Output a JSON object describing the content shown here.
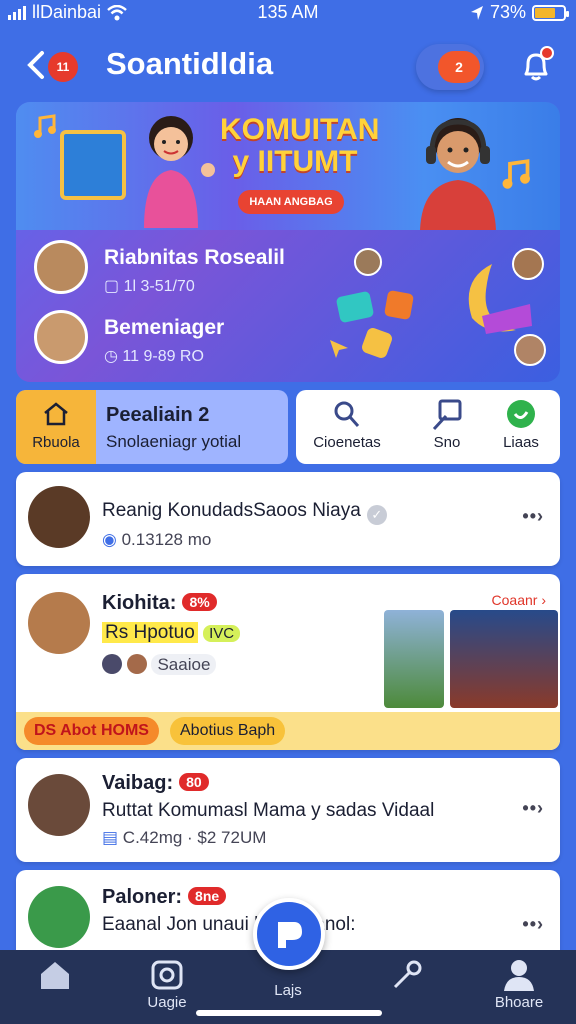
{
  "status_bar": {
    "carrier": "llDainbai",
    "time": "135 AM",
    "battery": "73%"
  },
  "header": {
    "back_badge": "11",
    "title": "Soantidldia",
    "message_badge": "2"
  },
  "banner": {
    "headline": "KOMUITAN y IITUMT",
    "button": "HAAN ANGBAG",
    "people": [
      {
        "name": "Riabnitas Rosealil",
        "time": "1l 3-51/70"
      },
      {
        "name": "Bemeniager",
        "time": "11 9-89 RO"
      }
    ]
  },
  "quick_actions": {
    "home_label": "Rbuola",
    "title": "Peealiain 2",
    "subtitle": "Snolaeniagr yotial",
    "items": [
      {
        "icon": "phone-search-icon",
        "label": "Cioenetas"
      },
      {
        "icon": "edit-icon",
        "label": "Sno"
      },
      {
        "icon": "whatsapp-icon",
        "label": "Liaas"
      }
    ]
  },
  "feed": [
    {
      "line": "Reanig KonudadsSaoos Niaya",
      "meta": "0.13128 mo"
    },
    {
      "name": "Kiohita:",
      "badge": "8%",
      "highlight": "Rs Hpotuo",
      "highlight_tag": "IVC",
      "meta": "Saaioe",
      "top_link": "Coaanr",
      "footer_tag": "DS Abot HOMS",
      "footer_text": "Abotius Baph"
    },
    {
      "name": "Vaibag:",
      "badge": "80",
      "line": "Ruttat Komumasl Mama y sadas Vidaal",
      "meta": "C.42mg · $2 72UM"
    },
    {
      "name": "Paloner:",
      "badge": "8ne",
      "line": "Eaanal Jon unaui laim esanol:"
    }
  ],
  "bottom_nav": [
    {
      "icon": "home-icon",
      "label": ""
    },
    {
      "icon": "camera-icon",
      "label": "Uagie"
    },
    {
      "icon": "play-icon",
      "label": "Lajs"
    },
    {
      "icon": "key-icon",
      "label": ""
    },
    {
      "icon": "profile-icon",
      "label": "Bhoare"
    }
  ],
  "colors": {
    "background": "#3f6ee6",
    "accent_red": "#e63a2c",
    "nav": "#253358"
  }
}
